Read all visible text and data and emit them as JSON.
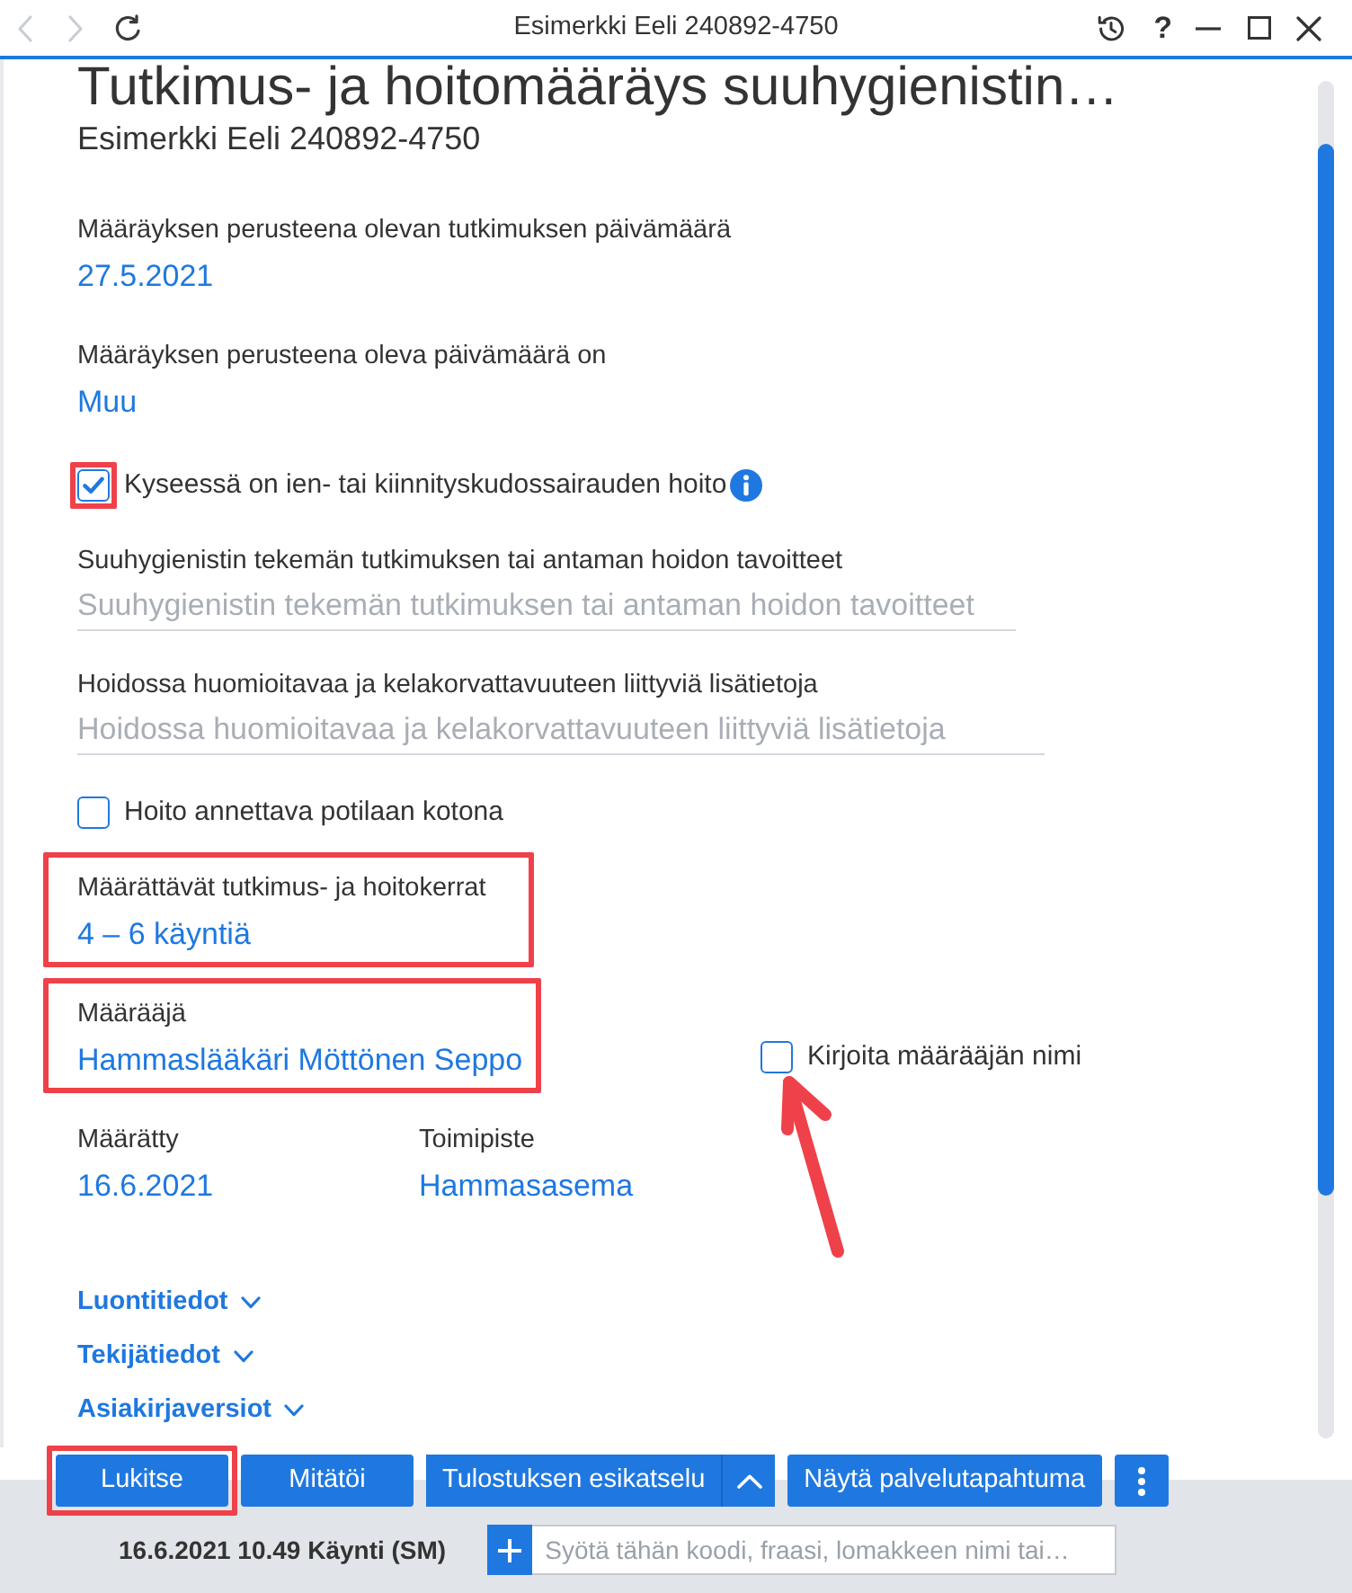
{
  "window": {
    "title": "Esimerkki Eeli 240892-4750",
    "nav": [
      {
        "kind": "back",
        "disabled": true
      },
      {
        "kind": "forward",
        "disabled": true
      },
      {
        "kind": "refresh",
        "disabled": false
      }
    ],
    "help": "?"
  },
  "header": {
    "title": "Tutkimus- ja hoitomääräys suuhygienistin…",
    "patient": "Esimerkki Eeli 240892-4750"
  },
  "form": [
    {
      "kind": "value",
      "label": "Määräyksen perusteena olevan tutkimuksen päivämäärä",
      "value": "27.5.2021",
      "highlighted": false
    },
    {
      "kind": "value",
      "label": "Määräyksen perusteena oleva päivämäärä on",
      "value": "Muu",
      "highlighted": false
    },
    {
      "kind": "checkbox",
      "label": "Kyseessä on ien- tai kiinnityskudossairauden hoito",
      "checked": true,
      "info": true,
      "highlighted": true
    },
    {
      "kind": "text",
      "label": "Suuhygienistin tekemän tutkimuksen tai antaman hoidon tavoitteet",
      "placeholder": "Suuhygienistin tekemän tutkimuksen tai antaman hoidon tavoitteet",
      "highlighted": false
    },
    {
      "kind": "text",
      "label": "Hoidossa huomioitavaa ja kelakorvattavuuteen liittyviä lisätietoja",
      "placeholder": "Hoidossa huomioitavaa ja kelakorvattavuuteen liittyviä lisätietoja",
      "highlighted": false
    },
    {
      "kind": "checkbox",
      "label": "Hoito annettava potilaan kotona",
      "checked": false,
      "info": false,
      "highlighted": false
    },
    {
      "kind": "value",
      "label": "Määrättävät tutkimus- ja hoitokerrat",
      "value": "4 – 6 käyntiä",
      "highlighted": true
    },
    {
      "kind": "prescriber",
      "label": "Määrääjä",
      "value": "Hammaslääkäri Möttönen Seppo",
      "highlighted": true,
      "option": {
        "label": "Kirjoita määrääjän nimi",
        "checked": false,
        "arrow": true
      }
    },
    {
      "kind": "pair",
      "highlighted": false,
      "items": [
        {
          "label": "Määrätty",
          "value": "16.6.2021"
        },
        {
          "label": "Toimipiste",
          "value": "Hammasasema"
        }
      ]
    }
  ],
  "sections": [
    {
      "label": "Luontitiedot",
      "expanded": false
    },
    {
      "label": "Tekijätiedot",
      "expanded": false
    },
    {
      "label": "Asiakirjaversiot",
      "expanded": false
    }
  ],
  "actions": [
    {
      "kind": "button",
      "label": "Lukitse",
      "highlighted": true
    },
    {
      "kind": "button",
      "label": "Mitätöi",
      "highlighted": false
    },
    {
      "kind": "split",
      "label": "Tulostuksen esikatselu",
      "highlighted": false
    },
    {
      "kind": "button",
      "label": "Näytä palvelutapahtuma",
      "highlighted": false
    },
    {
      "kind": "more",
      "highlighted": false
    }
  ],
  "status_bar": {
    "visit": "16.6.2021 10.49 Käynti (SM)",
    "command": {
      "placeholder": "Syötä tähän koodi, fraasi, lomakkeen nimi tai…"
    }
  }
}
